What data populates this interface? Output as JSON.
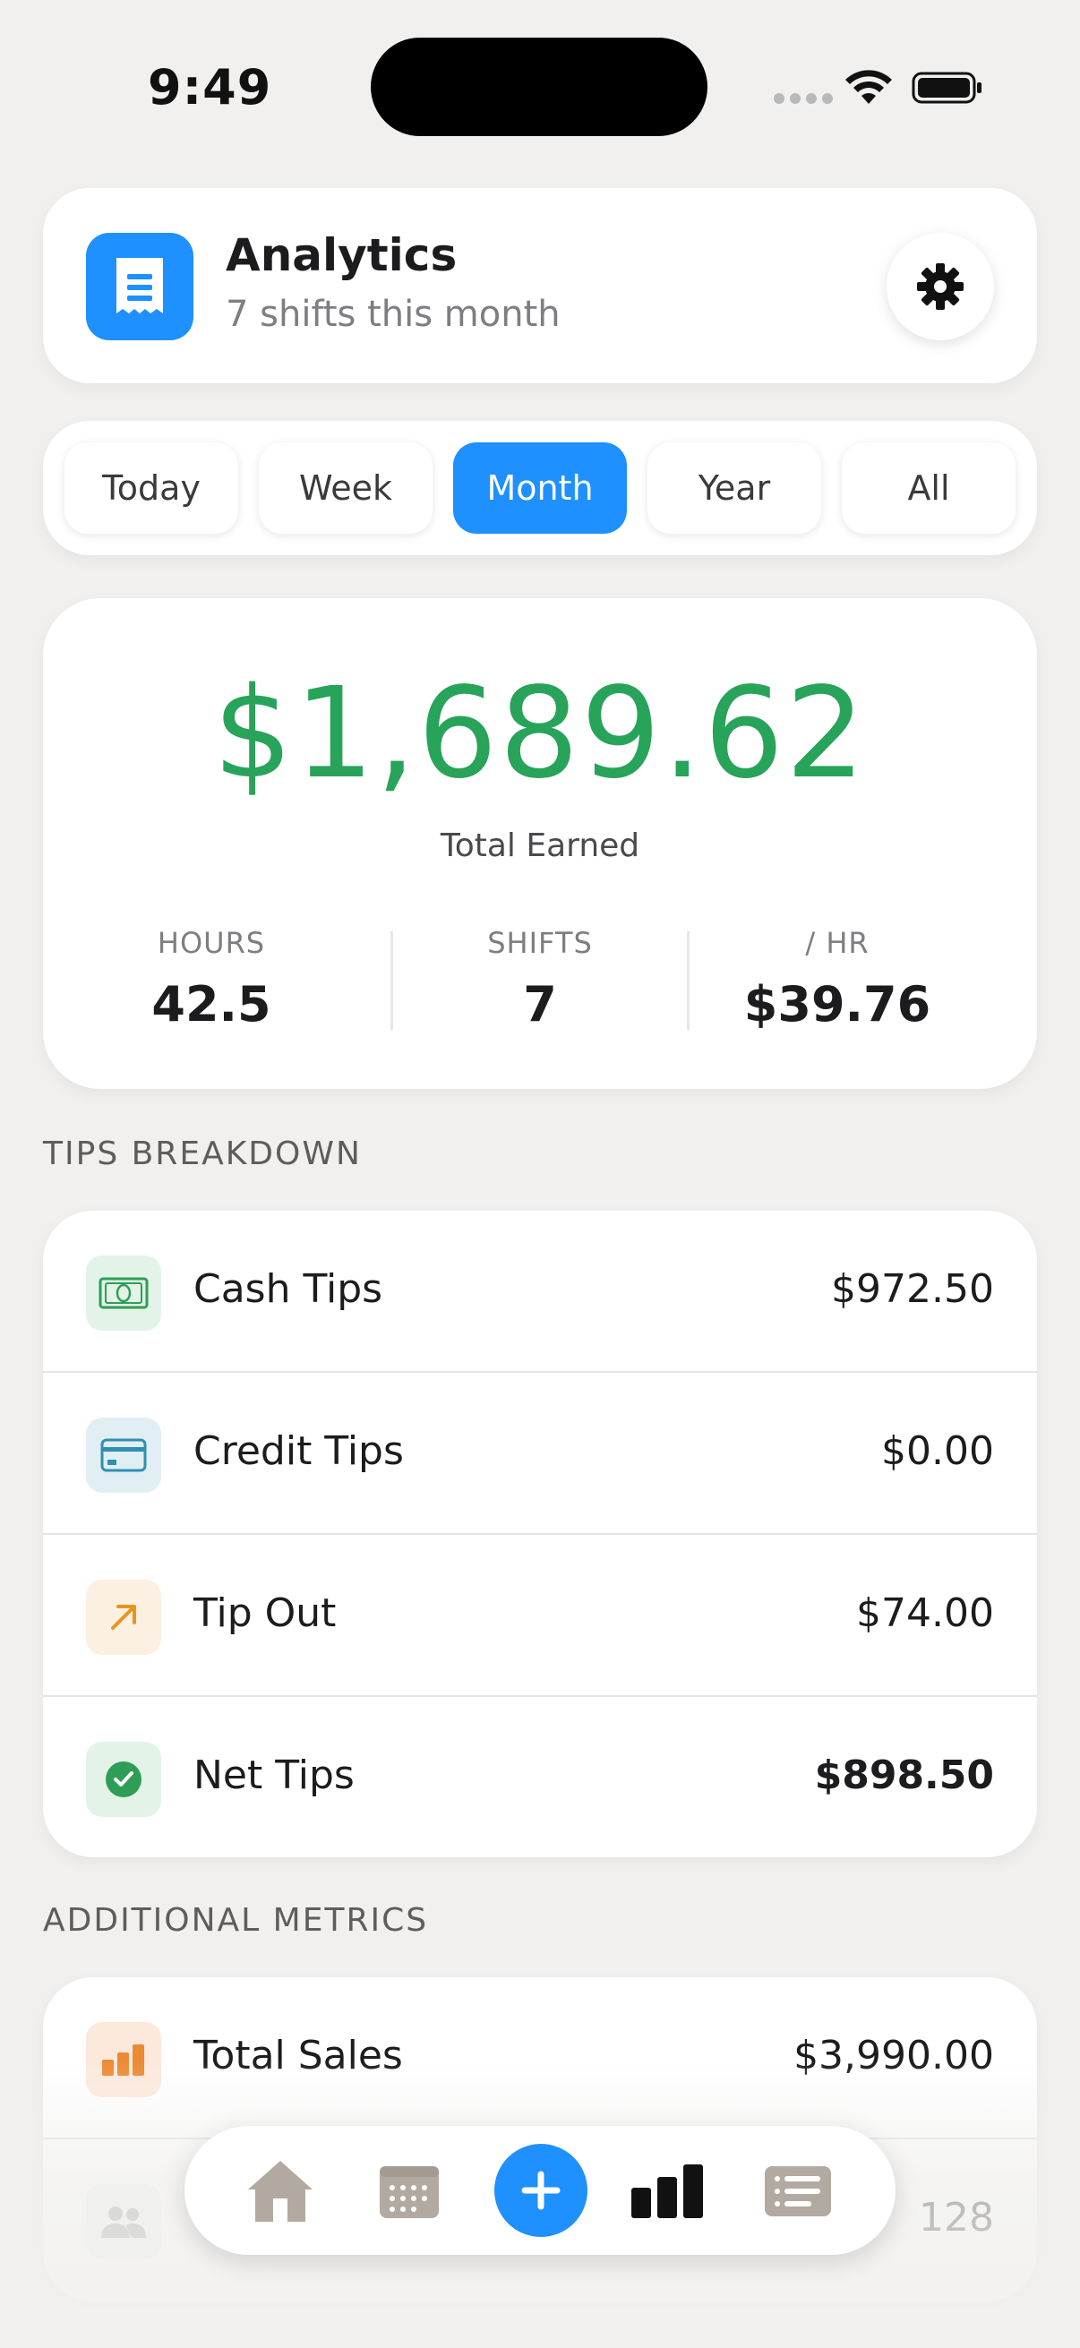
{
  "status_bar": {
    "time": "9:49"
  },
  "header": {
    "title": "Analytics",
    "subtitle": "7 shifts this month"
  },
  "segments": [
    {
      "label": "Today"
    },
    {
      "label": "Week"
    },
    {
      "label": "Month"
    },
    {
      "label": "Year"
    },
    {
      "label": "All"
    }
  ],
  "selected_segment": "Month",
  "summary": {
    "total_amount": "$1,689.62",
    "total_label": "Total Earned",
    "stats": [
      {
        "label": "HOURS",
        "value": "42.5"
      },
      {
        "label": "SHIFTS",
        "value": "7"
      },
      {
        "label": "/ HR",
        "value": "$39.76"
      }
    ]
  },
  "tips_section": {
    "title": "TIPS BREAKDOWN",
    "rows": [
      {
        "icon": "cash-icon",
        "label": "Cash Tips",
        "value": "$972.50"
      },
      {
        "icon": "credit-card-icon",
        "label": "Credit Tips",
        "value": "$0.00"
      },
      {
        "icon": "arrow-up-right-icon",
        "label": "Tip Out",
        "value": "$74.00"
      },
      {
        "icon": "checkmark-circle-icon",
        "label": "Net Tips",
        "value": "$898.50"
      }
    ]
  },
  "metrics_section": {
    "title": "ADDITIONAL METRICS",
    "rows": [
      {
        "icon": "bar-chart-icon",
        "label": "Total Sales",
        "value": "$3,990.00"
      },
      {
        "icon": "people-icon",
        "label": "",
        "value": "128"
      }
    ]
  },
  "colors": {
    "accent": "#1e90ff",
    "earnings_green": "#28a35a",
    "background": "#f1f0ee"
  },
  "tab_bar": {
    "tabs": [
      "home-icon",
      "calendar-icon",
      "add-icon",
      "chart-icon",
      "list-icon"
    ],
    "active": "chart-icon"
  }
}
